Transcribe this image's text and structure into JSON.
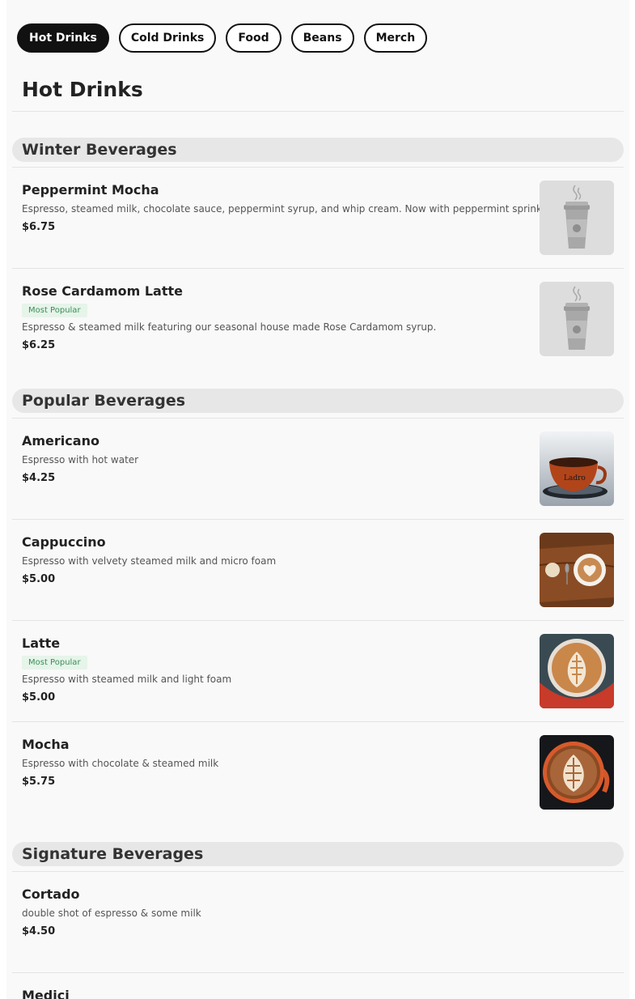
{
  "tabs": [
    {
      "label": "Hot Drinks",
      "active": true
    },
    {
      "label": "Cold Drinks",
      "active": false
    },
    {
      "label": "Food",
      "active": false
    },
    {
      "label": "Beans",
      "active": false
    },
    {
      "label": "Merch",
      "active": false
    }
  ],
  "page_title": "Hot Drinks",
  "sections": [
    {
      "title": "Winter Beverages",
      "items": [
        {
          "name": "Peppermint Mocha",
          "badge": "",
          "description": "Espresso, steamed milk, chocolate sauce, peppermint syrup, and whip cream. Now with peppermint sprinkles!",
          "price": "$6.75",
          "image": "cup-placeholder-icon"
        },
        {
          "name": "Rose Cardamom Latte",
          "badge": "Most Popular",
          "description": "Espresso & steamed milk featuring our seasonal house made Rose Cardamom syrup.",
          "price": "$6.25",
          "image": "cup-placeholder-icon"
        }
      ]
    },
    {
      "title": "Popular Beverages",
      "items": [
        {
          "name": "Americano",
          "badge": "",
          "description": "Espresso with hot water",
          "price": "$4.25",
          "image": "americano-photo"
        },
        {
          "name": "Cappuccino",
          "badge": "",
          "description": "Espresso with velvety steamed milk and micro foam",
          "price": "$5.00",
          "image": "cappuccino-photo"
        },
        {
          "name": "Latte",
          "badge": "Most Popular",
          "description": "Espresso with steamed milk and light foam",
          "price": "$5.00",
          "image": "latte-photo"
        },
        {
          "name": "Mocha",
          "badge": "",
          "description": "Espresso with chocolate & steamed milk",
          "price": "$5.75",
          "image": "mocha-photo"
        }
      ]
    },
    {
      "title": "Signature Beverages",
      "items": [
        {
          "name": "Cortado",
          "badge": "",
          "description": "double shot of espresso & some milk",
          "price": "$4.50",
          "image": ""
        },
        {
          "name": "Medici",
          "badge": "",
          "description": "",
          "price": "",
          "image": ""
        }
      ]
    }
  ],
  "colors": {
    "accent_tab_bg": "#111111",
    "badge_bg": "#e6f4ea",
    "badge_text": "#3a8f56",
    "section_bg": "#e7e7e7"
  }
}
